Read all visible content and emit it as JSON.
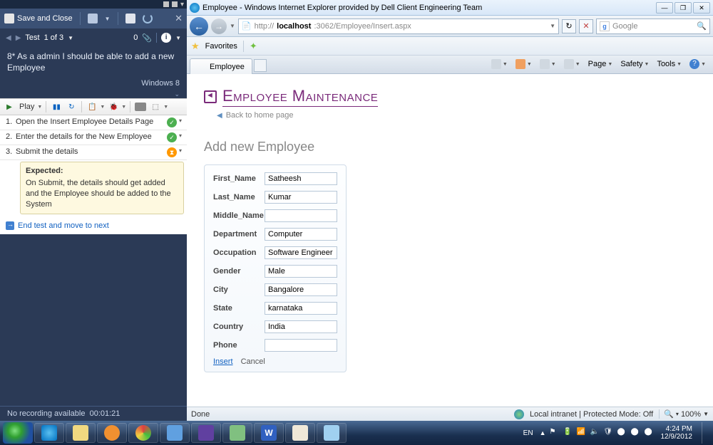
{
  "test_panel": {
    "save_close": "Save and Close",
    "test_counter_prefix": "Test",
    "test_counter": "1 of 3",
    "attach_count": "0",
    "test_title": "8* As a admin I should be able to add a new Employee",
    "environment": "Windows 8",
    "play_label": "Play",
    "steps": [
      {
        "n": "1.",
        "text": "Open the Insert Employee Details Page",
        "status": "pass"
      },
      {
        "n": "2.",
        "text": "Enter the details for the New Employee",
        "status": "pass"
      },
      {
        "n": "3.",
        "text": "Submit the details",
        "status": "active"
      }
    ],
    "expected_label": "Expected:",
    "expected_text": "On Submit, the details should get added and the Employee should be added to the System",
    "end_test": "End test and move to next",
    "recording_status": "No recording available",
    "elapsed": "00:01:21"
  },
  "browser": {
    "window_title": "Employee - Windows Internet Explorer provided by Dell Client Engineering Team",
    "url_prefix": "http://",
    "url_host": "localhost",
    "url_rest": ":3062/Employee/Insert.aspx",
    "search_placeholder": "Google",
    "favorites_label": "Favorites",
    "tab_label": "Employee",
    "tool_page": "Page",
    "tool_safety": "Safety",
    "tool_tools": "Tools",
    "status_done": "Done",
    "status_zone": "Local intranet | Protected Mode: Off",
    "status_zoom": "100%"
  },
  "page": {
    "heading": "Employee Maintenance",
    "back_link": "Back to home page",
    "subheading": "Add new Employee",
    "fields": {
      "first_name": {
        "label": "First_Name",
        "value": "Satheesh"
      },
      "last_name": {
        "label": "Last_Name",
        "value": "Kumar"
      },
      "middle_name": {
        "label": "Middle_Name",
        "value": ""
      },
      "department": {
        "label": "Department",
        "value": "Computer"
      },
      "occupation": {
        "label": "Occupation",
        "value": "Software Engineer"
      },
      "gender": {
        "label": "Gender",
        "value": "Male"
      },
      "city": {
        "label": "City",
        "value": "Bangalore"
      },
      "state": {
        "label": "State",
        "value": "karnataka"
      },
      "country": {
        "label": "Country",
        "value": "India"
      },
      "phone": {
        "label": "Phone",
        "value": ""
      }
    },
    "insert_action": "Insert",
    "cancel_action": "Cancel"
  },
  "taskbar": {
    "lang": "EN",
    "time": "4:24 PM",
    "date": "12/9/2012"
  }
}
